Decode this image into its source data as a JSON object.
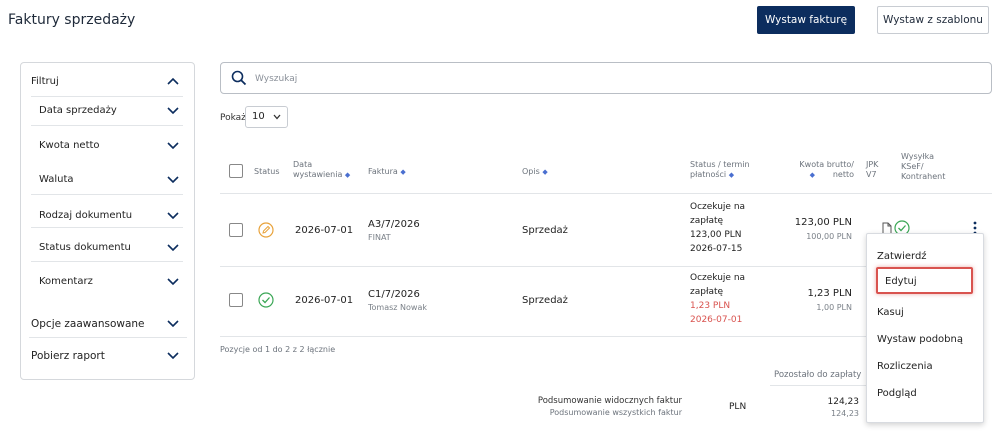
{
  "page": {
    "title": "Faktury sprzedaży",
    "btn_issue": "Wystaw fakturę",
    "btn_template": "Wystaw z szablonu"
  },
  "sidebar": {
    "filter_title": "Filtruj",
    "filters": [
      "Data sprzedaży",
      "Kwota netto",
      "Waluta",
      "Rodzaj dokumentu",
      "Status dokumentu",
      "Komentarz"
    ],
    "advanced": "Opcje zaawansowane",
    "report": "Pobierz raport"
  },
  "search": {
    "placeholder": "Wyszukaj"
  },
  "paging": {
    "label": "Pokaż",
    "value": "10"
  },
  "table": {
    "headers": {
      "status": "Status",
      "date1": "Data",
      "date2": "wystawienia",
      "invoice": "Faktura",
      "desc": "Opis",
      "pay1": "Status / termin",
      "pay2": "płatności",
      "amount1": "Kwota brutto/",
      "amount2": "netto",
      "jpk1": "JPK",
      "jpk2": "V7",
      "ksef1": "Wysyłka",
      "ksef2": "KSeF/",
      "ksef3": "Kontrahent"
    },
    "rows": [
      {
        "date": "2026-07-01",
        "number": "A3/7/2026",
        "client": "FINAT",
        "desc": "Sprzedaż",
        "pay_l1": "Oczekuje na",
        "pay_l2": "zapłatę",
        "pay_amount": "123,00 PLN",
        "pay_date": "2026-07-15",
        "gross": "123,00 PLN",
        "net": "100,00 PLN"
      },
      {
        "date": "2026-07-01",
        "number": "C1/7/2026",
        "client": "Tomasz Nowak",
        "desc": "Sprzedaż",
        "pay_l1": "Oczekuje na",
        "pay_l2": "zapłatę",
        "pay_amount": "1,23 PLN",
        "pay_date": "2026-07-01",
        "gross": "1,23 PLN",
        "net": "1,00 PLN"
      }
    ],
    "pager_info": "Pozycje od 1 do 2 z 2 łącznie"
  },
  "summary": {
    "remaining_label": "Pozostało do zapłaty",
    "visible_label": "Podsumowanie widocznych faktur",
    "all_label": "Podsumowanie wszystkich faktur",
    "currency": "PLN",
    "visible_value": "124,23",
    "all_value": "124,23"
  },
  "context_menu": {
    "items": [
      "Zatwierdź",
      "Edytuj",
      "Kasuj",
      "Wystaw podobną",
      "Rozliczenia",
      "Podgląd"
    ]
  },
  "colors": {
    "primary": "#0c2d5e",
    "pending": "#e8a23a",
    "ok": "#3aa655",
    "overdue": "#d9534f",
    "highlight": "#d9534f"
  }
}
